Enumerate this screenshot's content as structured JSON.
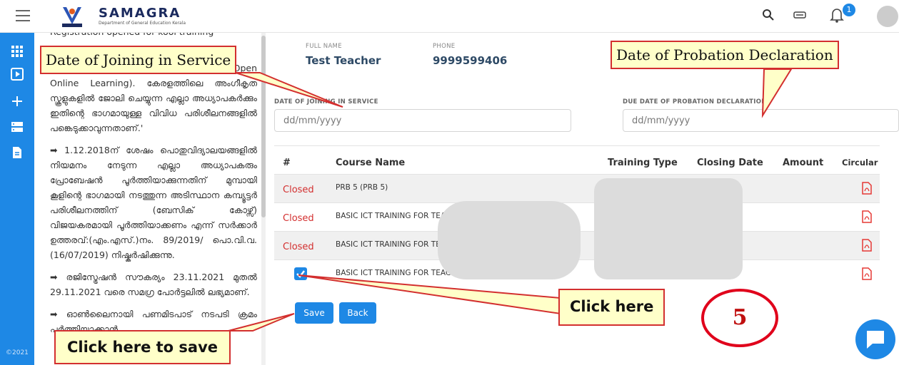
{
  "app": {
    "logo_text": "SAMAGRA",
    "logo_subtitle": "Department of General Education Kerala",
    "notification_count": "1",
    "copyright": "©2021"
  },
  "info_panel": {
    "paragraphs": [
      "Registration opened for kool training",
      "പരിശീലന പദ്ധതിയാണ് KOOL(KITE's Open Online Learning). കേരളത്തിലെ അംഗീകൃത സ്കൂളുകളിൽ ജോലി ചെയ്യുന്ന എല്ലാ അധ്യാപകർക്കും ഇതിന്റെ ഭാഗമായുള്ള വിവിധ പരിശീലനങ്ങളിൽ പങ്കെടുക്കാവുന്നതാണ്.'",
      "➡ 1.12.2018ന് ശേഷം പൊതുവിദ്യാലയങ്ങളിൽ നിയമനം നേടുന്ന എല്ലാ അധ്യാപകരും പ്രോബേഷൻ പൂർത്തിയാക്കുന്നതിന് മുമ്പായി കൂളിന്റെ ഭാഗമായി നടത്തുന്ന അടിസ്ഥാന കമ്പ്യൂട്ടർ പരിശീലനത്തിന് (ബേസിക് കോഴ്സ്) വിജയകരമായി പൂർത്തിയാക്കണം എന്ന് സർക്കാർ ഉത്തരവ്:(എം.എസ്.)നം. 89/2019/ പൊ.വി.വ.(16/07/2019) നിഷ്കർഷിക്കുന്നു.",
      "➡ രജിസ്ട്രേഷൻ സൗകര്യം 23.11.2021 മുതൽ 29.11.2021 വരെ സമഗ്ര പോർട്ടലിൽ ലഭ്യമാണ്.",
      "➡ ഓൺലൈനായി പണമിടപാട് നടപടി ക്രമം പൂർത്തിയാക്കാൻ"
    ]
  },
  "profile": {
    "full_name_label": "FULL NAME",
    "full_name": "Test Teacher",
    "phone_label": "PHONE",
    "phone": "9999599406"
  },
  "form": {
    "doj_label": "DATE OF JOINING IN SERVICE",
    "doj_placeholder": "dd/mm/yyyy",
    "probation_label": "DUE DATE OF PROBATION DECLARATION",
    "probation_placeholder": "dd/mm/yyyy"
  },
  "table": {
    "headers": [
      "#",
      "Course Name",
      "Training Type",
      "Closing Date",
      "Amount",
      "Circular"
    ],
    "rows": [
      {
        "status": "Closed",
        "course": "PRB 5  (PRB 5)"
      },
      {
        "status": "Closed",
        "course": "BASIC ICT TRAINING FOR TEACHER"
      },
      {
        "status": "Closed",
        "course": "BASIC ICT TRAINING FOR TEAC"
      },
      {
        "status": "",
        "course": "BASIC ICT TRAINING FOR TEACHE"
      }
    ]
  },
  "buttons": {
    "save": "Save",
    "back": "Back"
  },
  "annotations": {
    "doj": "Date of Joining in Service",
    "probation": "Date of Probation Declaration",
    "click_here": "Click here",
    "click_to_save": "Click here to save",
    "step": "5"
  },
  "colors": {
    "primary": "#1e88e5",
    "closed": "#d32f2f",
    "callout_bg": "#ffffc9",
    "callout_border": "#d32f2f"
  }
}
